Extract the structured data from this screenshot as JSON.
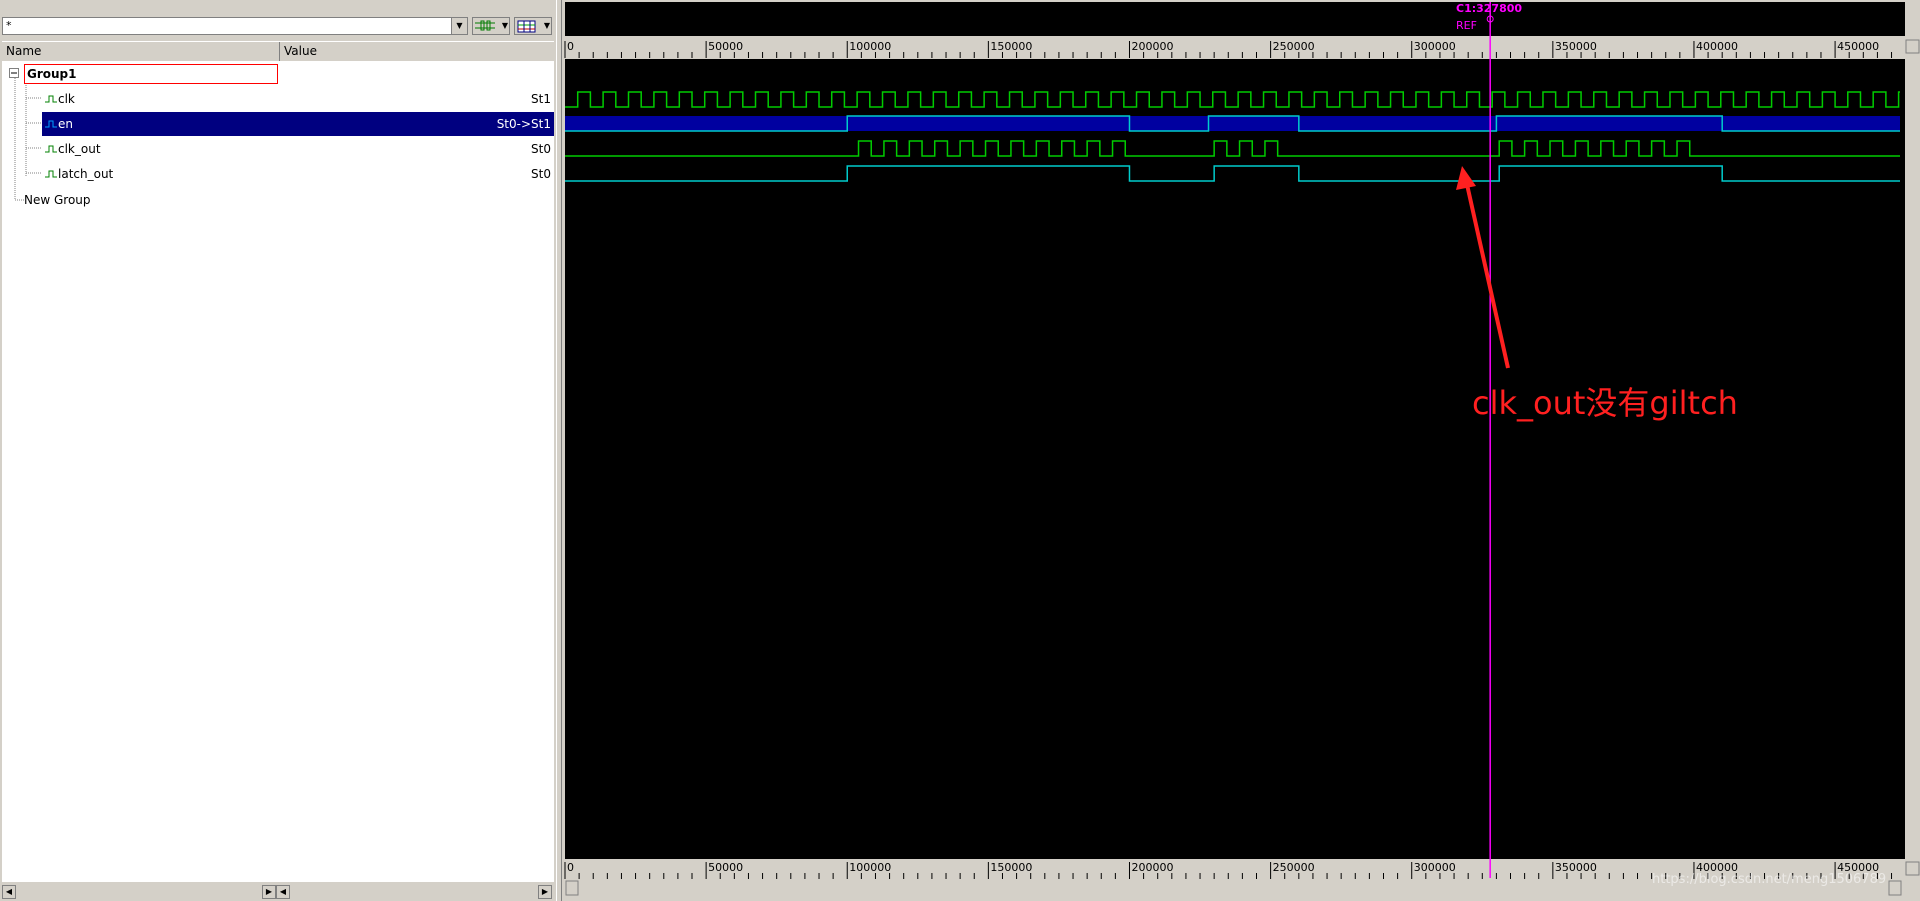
{
  "filter": {
    "value": "*"
  },
  "columns": {
    "name": "Name",
    "value": "Value"
  },
  "group": {
    "name": "Group1"
  },
  "signals": [
    {
      "name": "clk",
      "value": "St1"
    },
    {
      "name": "en",
      "value": "St0->St1"
    },
    {
      "name": "clk_out",
      "value": "St0"
    },
    {
      "name": "latch_out",
      "value": "St0"
    }
  ],
  "new_group": "New Group",
  "cursor": {
    "label": "C1:327800",
    "ref": "REF",
    "color": "#ff00ff"
  },
  "ruler": {
    "ticks": [
      "0",
      "50000",
      "100000",
      "150000",
      "200000",
      "250000",
      "300000",
      "350000",
      "400000",
      "450000"
    ]
  },
  "annotation": {
    "text": "clk_out没有giltch",
    "color": "#ff2020"
  },
  "watermark": "https://blog.csdn.net/meng1506789",
  "colors": {
    "wave_bg": "#000000",
    "clk": "#00cc00",
    "bus_fill": "#0000a0",
    "line": "#00cccc",
    "selected": "#000080"
  },
  "icons": {
    "tree_expand": "minus-box-icon",
    "signal": "waveform-icon"
  }
}
